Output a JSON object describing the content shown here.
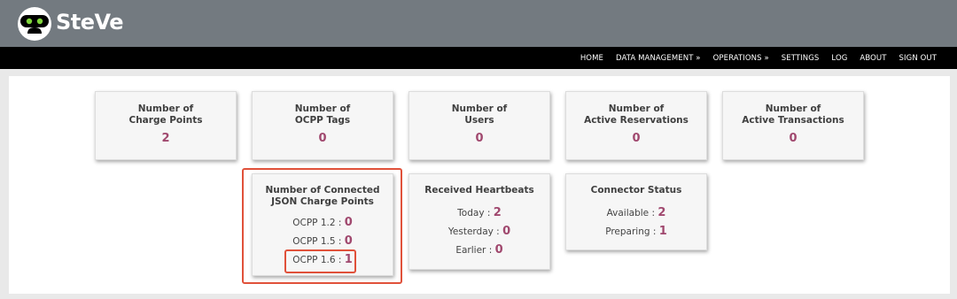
{
  "header": {
    "app_name": "SteVe",
    "logo_icon": "steve-robot-logo"
  },
  "nav": {
    "items": [
      "HOME",
      "DATA MANAGEMENT »",
      "OPERATIONS »",
      "SETTINGS",
      "LOG",
      "ABOUT",
      "SIGN OUT"
    ]
  },
  "stats": {
    "charge_points": {
      "title_1": "Number of",
      "title_2": "Charge Points",
      "value": "2"
    },
    "ocpp_tags": {
      "title_1": "Number of",
      "title_2": "OCPP Tags",
      "value": "0"
    },
    "users": {
      "title_1": "Number of",
      "title_2": "Users",
      "value": "0"
    },
    "active_reservations": {
      "title_1": "Number of",
      "title_2": "Active Reservations",
      "value": "0"
    },
    "active_transactions": {
      "title_1": "Number of",
      "title_2": "Active Transactions",
      "value": "0"
    },
    "connected_json": {
      "title_1": "Number of Connected",
      "title_2": "JSON Charge Points",
      "rows": [
        {
          "label": "OCPP 1.2 : ",
          "value": "0"
        },
        {
          "label": "OCPP 1.5 : ",
          "value": "0"
        },
        {
          "label": "OCPP 1.6 : ",
          "value": "1"
        }
      ]
    },
    "heartbeats": {
      "title": "Received Heartbeats",
      "rows": [
        {
          "label": "Today : ",
          "value": "2"
        },
        {
          "label": "Yesterday : ",
          "value": "0"
        },
        {
          "label": "Earlier : ",
          "value": "0"
        }
      ]
    },
    "connector_status": {
      "title": "Connector Status",
      "rows": [
        {
          "label": "Available : ",
          "value": "2"
        },
        {
          "label": "Preparing : ",
          "value": "1"
        }
      ]
    }
  },
  "colors": {
    "header_bg": "#737a80",
    "navbar_bg": "#000000",
    "value_color": "#a0486e",
    "highlight_color": "#e0513a"
  }
}
